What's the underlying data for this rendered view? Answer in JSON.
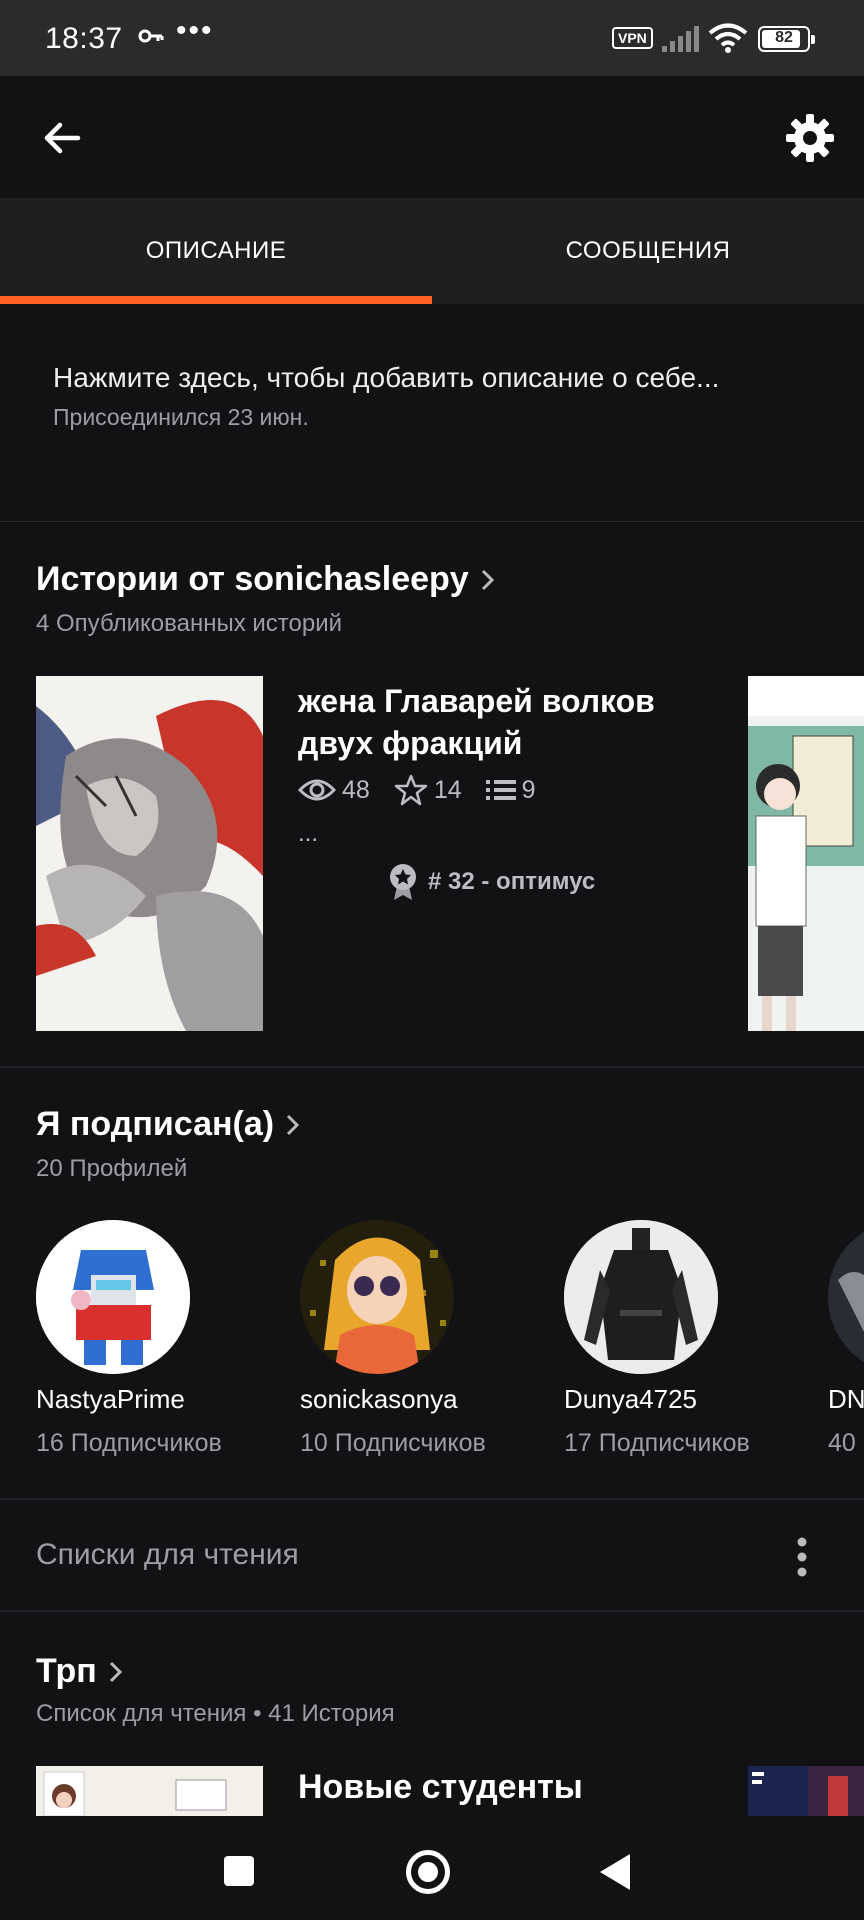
{
  "status_bar": {
    "time": "18:37",
    "dots": "•••",
    "vpn": "VPN",
    "battery": "82"
  },
  "toolbar": {
    "back_icon": "arrow-left-icon",
    "settings_icon": "gear-icon"
  },
  "tabs": [
    {
      "label": "ОПИСАНИЕ",
      "active": true
    },
    {
      "label": "СООБЩЕНИЯ",
      "active": false
    }
  ],
  "accent_color": "#ff6122",
  "description": {
    "prompt": "Нажмите здесь, чтобы добавить описание о себе...",
    "joined": "Присоединился 23 июн."
  },
  "stories": {
    "title": "Истории от sonichasleepy",
    "subtitle": "4 Опубликованных историй",
    "items": [
      {
        "title": "жена Главарей волков двух фракций",
        "views": "48",
        "votes": "14",
        "parts": "9",
        "excerpt": "...",
        "rank": "# 32 - оптимус"
      }
    ]
  },
  "following": {
    "title": "Я подписан(а)",
    "subtitle": "20 Профилей",
    "profiles": [
      {
        "name": "NastyaPrime",
        "followers": "16 Подписчиков"
      },
      {
        "name": "sonickasonya",
        "followers": "10 Подписчиков"
      },
      {
        "name": "Dunya4725",
        "followers": "17 Подписчиков"
      },
      {
        "name": "DN",
        "followers": "40"
      }
    ]
  },
  "reading_lists": {
    "label": "Списки для чтения",
    "lists": [
      {
        "title": "Трп",
        "subtitle": "Список для чтения • 41 История",
        "first_story": "Новые студенты"
      }
    ]
  }
}
